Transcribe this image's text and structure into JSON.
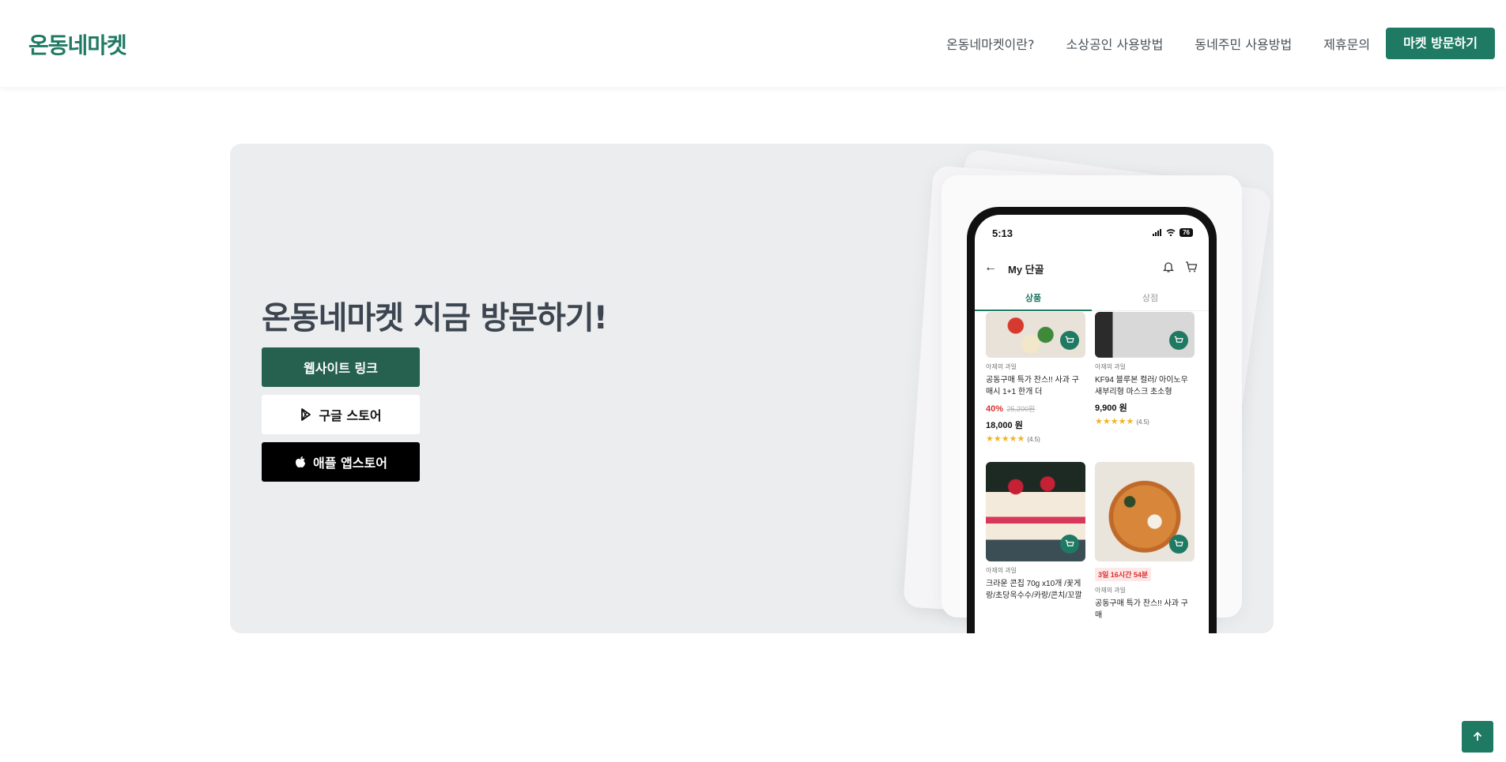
{
  "header": {
    "logo": "온동네마켓",
    "nav": [
      "온동네마켓이란?",
      "소상공인 사용방법",
      "동네주민 사용방법",
      "제휴문의"
    ],
    "cta": "마켓 방문하기"
  },
  "hero": {
    "title_highlight": "온동네마켓",
    "title_rest": " 지금 방문하기!",
    "buttons": {
      "website": "웹사이트 링크",
      "google": "구글 스토어",
      "apple": "애플 앱스토어"
    }
  },
  "phone": {
    "time": "5:13",
    "battery": "76",
    "screen_title": "My 단골",
    "tabs": [
      "상품",
      "상점"
    ],
    "products": [
      {
        "category": "아재의 과일",
        "name": "공동구매 특가 찬스!! 사과 구매시 1+1 한개 더",
        "discount": "40%",
        "orig": "25,200원",
        "price": "18,000 원",
        "stars": "★★★★★",
        "rating": "(4.5)"
      },
      {
        "category": "아재의 과일",
        "name": "KF94 블루본 컬러/ 아이노우 새부리형 마스크 초소형",
        "price": "9,900 원",
        "stars": "★★★★★",
        "rating": "(4.5)"
      },
      {
        "category": "아재의 과일",
        "name": "크라운 콘칩 70g x10개 /꽃게랑/초당옥수수/카랑/콘치/꼬깔"
      },
      {
        "timer": "3일 16시간 54분",
        "category": "아재의 과일",
        "name": "공동구매 특가 찬스!! 사과 구매"
      }
    ]
  },
  "colors": {
    "brand": "#1f7a64",
    "hero_bg": "#ebedef",
    "website_btn": "#26604f"
  }
}
